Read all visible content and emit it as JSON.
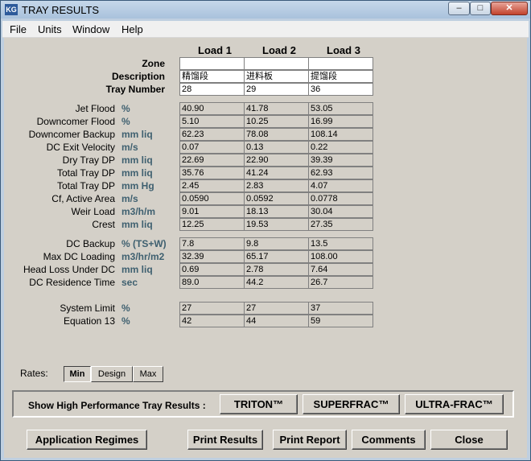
{
  "window": {
    "title": "TRAY RESULTS",
    "app_icon": "KG",
    "minimize": "‒",
    "maximize": "□",
    "close": "✕"
  },
  "menu": [
    "File",
    "Units",
    "Window",
    "Help"
  ],
  "columns": [
    "Load 1",
    "Load 2",
    "Load 3"
  ],
  "header_rows": [
    {
      "label": "Zone",
      "values": [
        "",
        "",
        ""
      ]
    },
    {
      "label": "Description",
      "values": [
        "精馏段",
        "进料板",
        "提馏段"
      ]
    },
    {
      "label": "Tray Number",
      "values": [
        "28",
        "29",
        "36"
      ]
    }
  ],
  "group1": [
    {
      "label": "Jet Flood",
      "unit": "%",
      "values": [
        "40.90",
        "41.78",
        "53.05"
      ]
    },
    {
      "label": "Downcomer Flood",
      "unit": "%",
      "values": [
        "5.10",
        "10.25",
        "16.99"
      ]
    },
    {
      "label": "Downcomer Backup",
      "unit": "mm liq",
      "values": [
        "62.23",
        "78.08",
        "108.14"
      ]
    },
    {
      "label": "DC Exit Velocity",
      "unit": "m/s",
      "values": [
        "0.07",
        "0.13",
        "0.22"
      ]
    },
    {
      "label": "Dry Tray DP",
      "unit": "mm liq",
      "values": [
        "22.69",
        "22.90",
        "39.39"
      ]
    },
    {
      "label": "Total Tray DP",
      "unit": "mm liq",
      "values": [
        "35.76",
        "41.24",
        "62.93"
      ]
    },
    {
      "label": "Total Tray DP",
      "unit": "mm Hg",
      "values": [
        "2.45",
        "2.83",
        "4.07"
      ]
    },
    {
      "label": "Cf, Active Area",
      "unit": "m/s",
      "values": [
        "0.0590",
        "0.0592",
        "0.0778"
      ]
    },
    {
      "label": "Weir Load",
      "unit": "m3/h/m",
      "values": [
        "9.01",
        "18.13",
        "30.04"
      ]
    },
    {
      "label": "Crest",
      "unit": "mm liq",
      "values": [
        "12.25",
        "19.53",
        "27.35"
      ]
    }
  ],
  "group2": [
    {
      "label": "DC Backup",
      "unit": "% (TS+W)",
      "values": [
        "7.8",
        "9.8",
        "13.5"
      ]
    },
    {
      "label": "Max DC Loading",
      "unit": "m3/hr/m2",
      "values": [
        "32.39",
        "65.17",
        "108.00"
      ]
    },
    {
      "label": "Head Loss Under DC",
      "unit": "mm liq",
      "values": [
        "0.69",
        "2.78",
        "7.64"
      ]
    },
    {
      "label": "DC Residence Time",
      "unit": "sec",
      "values": [
        "89.0",
        "44.2",
        "26.7"
      ]
    }
  ],
  "group3": [
    {
      "label": "System Limit",
      "unit": "%",
      "values": [
        "27",
        "27",
        "37"
      ]
    },
    {
      "label": "Equation 13",
      "unit": "%",
      "values": [
        "42",
        "44",
        "59"
      ]
    }
  ],
  "rates": {
    "label": "Rates:",
    "options": [
      "Min",
      "Design",
      "Max"
    ],
    "selected": "Min"
  },
  "hp": {
    "label": "Show High Performance Tray Results :",
    "buttons": [
      "TRITON™",
      "SUPERFRAC™",
      "ULTRA-FRAC™"
    ]
  },
  "bottom_buttons": [
    "Application Regimes",
    "Print Results",
    "Print Report",
    "Comments",
    "Close"
  ]
}
